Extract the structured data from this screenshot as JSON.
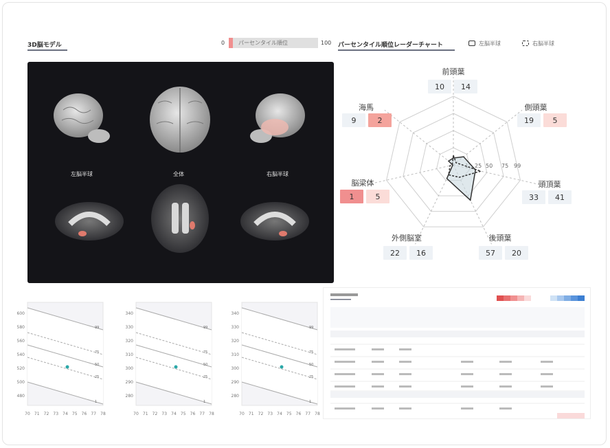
{
  "model_tab": {
    "label": "3D脳モデル"
  },
  "scale": {
    "min": "0",
    "max": "100",
    "label": "パーセンタイル順位"
  },
  "radar_tab": {
    "label": "パーセンタイル順位レーダーチャート"
  },
  "legend": {
    "left": "左脳半球",
    "right": "右脳半球"
  },
  "brain_views": {
    "left": "左脳半球",
    "whole": "全体",
    "right": "右脳半球"
  },
  "radar": {
    "ring_ticks": [
      "1",
      "25",
      "50",
      "75",
      "99"
    ],
    "regions": [
      {
        "name": "前頭葉",
        "left": "10",
        "right": "14"
      },
      {
        "name": "側頭葉",
        "left": "19",
        "right": "5"
      },
      {
        "name": "頭頂葉",
        "left": "33",
        "right": "41"
      },
      {
        "name": "後頭葉",
        "left": "57",
        "right": "20"
      },
      {
        "name": "外側脳室",
        "left": "22",
        "right": "16"
      },
      {
        "name": "脳梁体",
        "left": "1",
        "right": "5"
      },
      {
        "name": "海馬",
        "left": "9",
        "right": "2"
      }
    ]
  },
  "growth_charts": [
    {
      "yticks": [
        "600",
        "580",
        "560",
        "540",
        "520",
        "500",
        "480"
      ],
      "xticks": [
        "70",
        "71",
        "72",
        "73",
        "74",
        "75",
        "76",
        "77",
        "78"
      ]
    },
    {
      "yticks": [
        "340",
        "330",
        "320",
        "310",
        "300",
        "290",
        "280"
      ],
      "xticks": [
        "70",
        "71",
        "72",
        "73",
        "74",
        "75",
        "76",
        "77",
        "78"
      ]
    },
    {
      "yticks": [
        "340",
        "330",
        "320",
        "310",
        "300",
        "290",
        "280"
      ],
      "xticks": [
        "70",
        "71",
        "72",
        "73",
        "74",
        "75",
        "76",
        "77",
        "78"
      ]
    }
  ],
  "percentile_lines": [
    "99",
    "75",
    "50",
    "25",
    "1"
  ],
  "colors": {
    "accent_red": "#f08f8f",
    "accent_blue": "#4d8fd6",
    "point": "#2aa8a8"
  }
}
